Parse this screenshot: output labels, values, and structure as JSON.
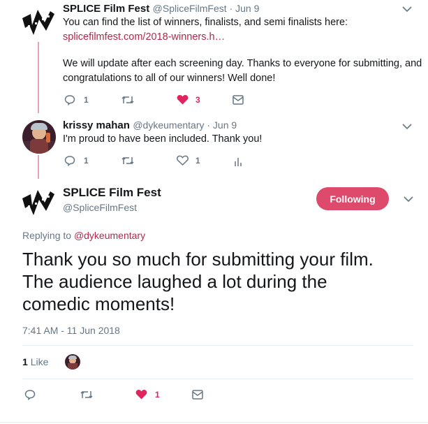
{
  "tweet1": {
    "name": "SPLICE Film Fest",
    "handle_date": "@SpliceFilmFest · Jun 9",
    "line1": "You can find the list of winners, finalists, and semi finalists here:",
    "link": "splicefilmfest.com/2018-winners.h…",
    "line2": "We will update after each screening day. Thanks to everyone for submitting, and",
    "line3": "congratulations to all of our winners! Well done!",
    "replies": "1",
    "likes": "3"
  },
  "tweet2": {
    "name": "krissy mahan",
    "handle_date": "@dykeumentary · Jun 9",
    "text": "I'm proud to have been included. Thank you!",
    "replies": "1",
    "likes": "1"
  },
  "main": {
    "name": "SPLICE Film Fest",
    "handle": "@SpliceFilmFest",
    "follow_label": "Following",
    "replying_prefix": "Replying to ",
    "replying_handle": "@dykeumentary",
    "text_line1": "Thank you so much for submitting your film.",
    "text_line2": "The audience laughed a lot during the",
    "text_line3": "comedic moments!",
    "timestamp": "7:41 AM - 11 Jun 2018",
    "like_count": "1",
    "like_label": "Like",
    "action_like_count": "1"
  },
  "colors": {
    "accent": "#de4a6c",
    "link": "#b0294b",
    "heart": "#e0245e",
    "muted": "#657786"
  }
}
